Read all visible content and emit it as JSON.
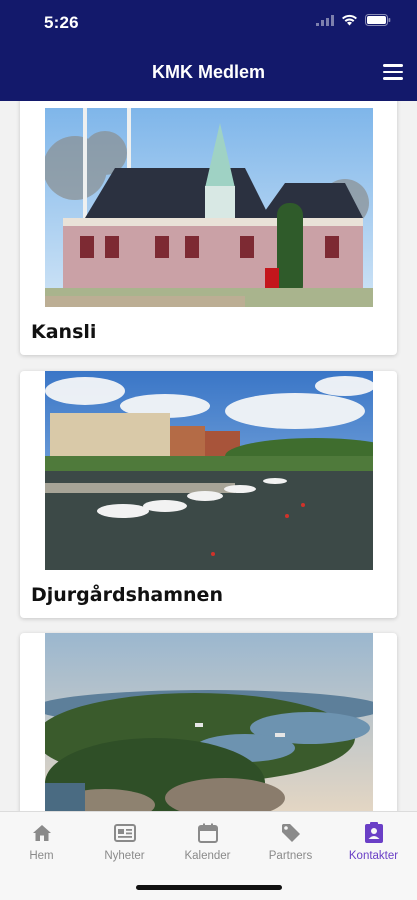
{
  "status": {
    "time": "5:26"
  },
  "header": {
    "title": "KMK Medlem"
  },
  "cards": [
    {
      "title": "Kansli"
    },
    {
      "title": "Djurgårdshamnen"
    },
    {
      "title": ""
    }
  ],
  "tabs": [
    {
      "label": "Hem",
      "icon": "home-icon"
    },
    {
      "label": "Nyheter",
      "icon": "news-icon"
    },
    {
      "label": "Kalender",
      "icon": "calendar-icon"
    },
    {
      "label": "Partners",
      "icon": "tag-icon"
    },
    {
      "label": "Kontakter",
      "icon": "contact-card-icon",
      "active": true
    }
  ],
  "colors": {
    "header": "#13196b",
    "active_tab": "#6a3fc6",
    "inactive_tab": "#8a8a8a"
  }
}
